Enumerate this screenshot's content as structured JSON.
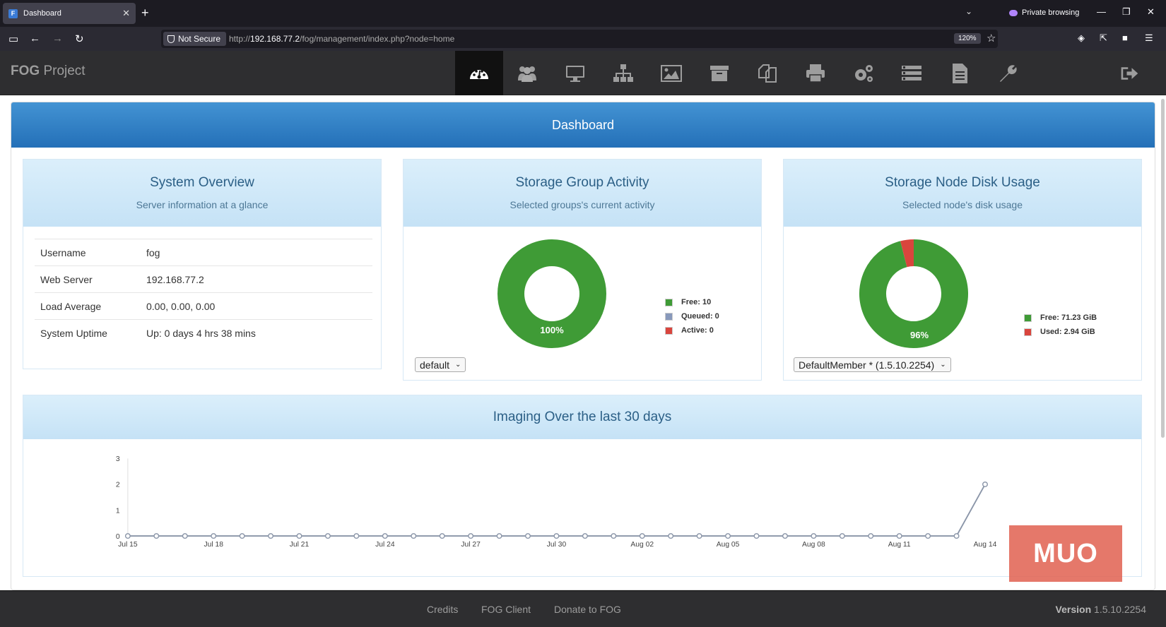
{
  "browser": {
    "tab_title": "Dashboard",
    "tab_favicon": "F",
    "private_label": "Private browsing",
    "not_secure": "Not Secure",
    "url_prefix": "http://",
    "url_host": "192.168.77.2",
    "url_path": "/fog/management/index.php?node=home",
    "zoom": "120%"
  },
  "app": {
    "brand_bold": "FOG",
    "brand_rest": " Project",
    "menu": [
      {
        "name": "dashboard-icon",
        "active": true
      },
      {
        "name": "users-icon"
      },
      {
        "name": "hosts-monitor-icon"
      },
      {
        "name": "groups-sitemap-icon"
      },
      {
        "name": "images-icon"
      },
      {
        "name": "storage-archive-icon"
      },
      {
        "name": "snapins-copy-icon"
      },
      {
        "name": "printers-icon"
      },
      {
        "name": "service-cogs-icon"
      },
      {
        "name": "tasks-tasklist-icon"
      },
      {
        "name": "reports-file-icon"
      },
      {
        "name": "settings-wrench-icon"
      }
    ]
  },
  "dashboard": {
    "title": "Dashboard",
    "overview": {
      "title": "System Overview",
      "subtitle": "Server information at a glance",
      "rows": [
        {
          "key": "Username",
          "value": "fog"
        },
        {
          "key": "Web Server",
          "value": "192.168.77.2"
        },
        {
          "key": "Load Average",
          "value": "0.00, 0.00, 0.00"
        },
        {
          "key": "System Uptime",
          "value": "Up: 0 days 4 hrs 38 mins"
        }
      ]
    },
    "group_activity": {
      "title": "Storage Group Activity",
      "subtitle": "Selected groups's current activity",
      "percent_label": "100%",
      "legend": [
        "Free: 10",
        "Queued: 0",
        "Active: 0"
      ],
      "select_value": "default",
      "values": {
        "free": 10,
        "queued": 0,
        "active": 0
      }
    },
    "disk_usage": {
      "title": "Storage Node Disk Usage",
      "subtitle": "Selected node's disk usage",
      "percent_label": "96%",
      "legend": [
        "Free: 71.23 GiB",
        "Used: 2.94 GiB"
      ],
      "select_value": "DefaultMember * (1.5.10.2254)",
      "values": {
        "free": 71.23,
        "used": 2.94
      }
    },
    "imaging": {
      "title": "Imaging Over the last 30 days"
    }
  },
  "colors": {
    "green": "#3f9b36",
    "blue": "#8899bb",
    "red": "#d9453d",
    "accent": "#2c7fc5"
  },
  "footer": {
    "links": [
      "Credits",
      "FOG Client",
      "Donate to FOG"
    ],
    "version_label": "Version",
    "version_value": "1.5.10.2254"
  },
  "watermark": "MUO",
  "chart_data": {
    "type": "line",
    "title": "Imaging Over the last 30 days",
    "x": [
      "Jul 15",
      "Jul 16",
      "Jul 17",
      "Jul 18",
      "Jul 19",
      "Jul 20",
      "Jul 21",
      "Jul 22",
      "Jul 23",
      "Jul 24",
      "Jul 25",
      "Jul 26",
      "Jul 27",
      "Jul 28",
      "Jul 29",
      "Jul 30",
      "Jul 31",
      "Aug 01",
      "Aug 02",
      "Aug 03",
      "Aug 04",
      "Aug 05",
      "Aug 06",
      "Aug 07",
      "Aug 08",
      "Aug 09",
      "Aug 10",
      "Aug 11",
      "Aug 12",
      "Aug 13",
      "Aug 14"
    ],
    "xticks": [
      "Jul 15",
      "Jul 18",
      "Jul 21",
      "Jul 24",
      "Jul 27",
      "Jul 30",
      "Aug 02",
      "Aug 05",
      "Aug 08",
      "Aug 11",
      "Aug 14"
    ],
    "series": [
      {
        "values": [
          0,
          0,
          0,
          0,
          0,
          0,
          0,
          0,
          0,
          0,
          0,
          0,
          0,
          0,
          0,
          0,
          0,
          0,
          0,
          0,
          0,
          0,
          0,
          0,
          0,
          0,
          0,
          0,
          0,
          0,
          2
        ]
      }
    ],
    "ylim": [
      0,
      3
    ],
    "yticks": [
      0,
      1,
      2,
      3
    ],
    "grid": true
  }
}
